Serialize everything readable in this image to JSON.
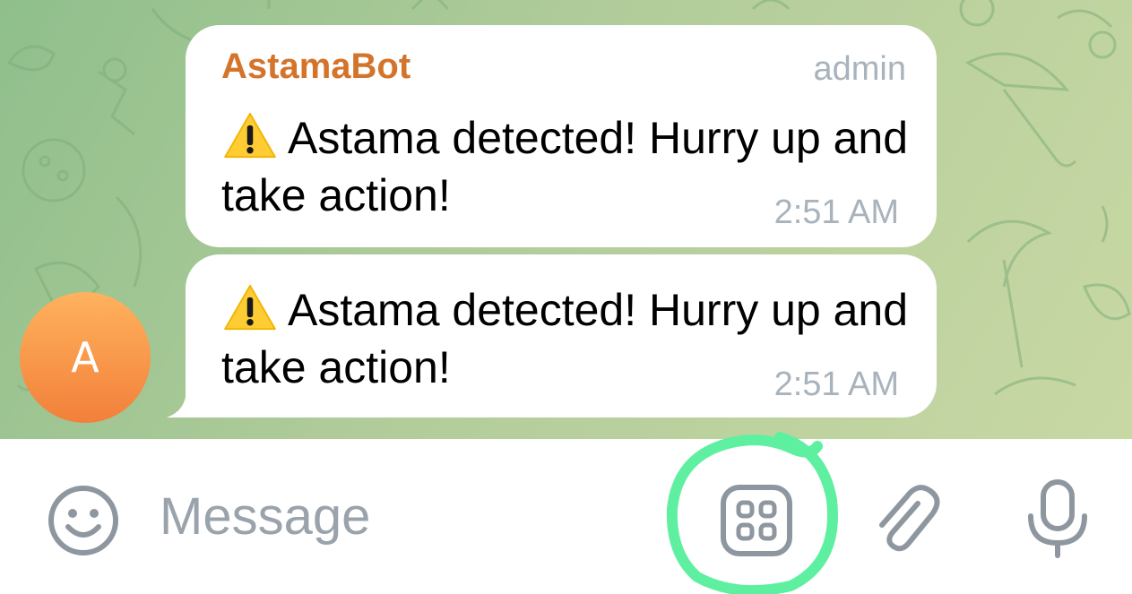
{
  "chat": {
    "avatar_letter": "A",
    "messages": [
      {
        "sender": "AstamaBot",
        "role": "admin",
        "emoji": "⚠️",
        "text": "Astama detected! Hurry up and take action!",
        "time": "2:51 AM"
      },
      {
        "emoji": "⚠️",
        "text": "Astama detected! Hurry up and take action!",
        "time": "2:51 AM"
      }
    ]
  },
  "input_bar": {
    "placeholder": "Message",
    "icons": [
      "emoji-icon",
      "bot-apps-icon",
      "paperclip-icon",
      "microphone-icon"
    ]
  },
  "colors": {
    "sender": "#d4742b",
    "meta_text": "#a9b3bc",
    "highlight_circle": "#5ef0a0",
    "avatar": "#f28a3e",
    "icon_gray": "#8e979f"
  }
}
